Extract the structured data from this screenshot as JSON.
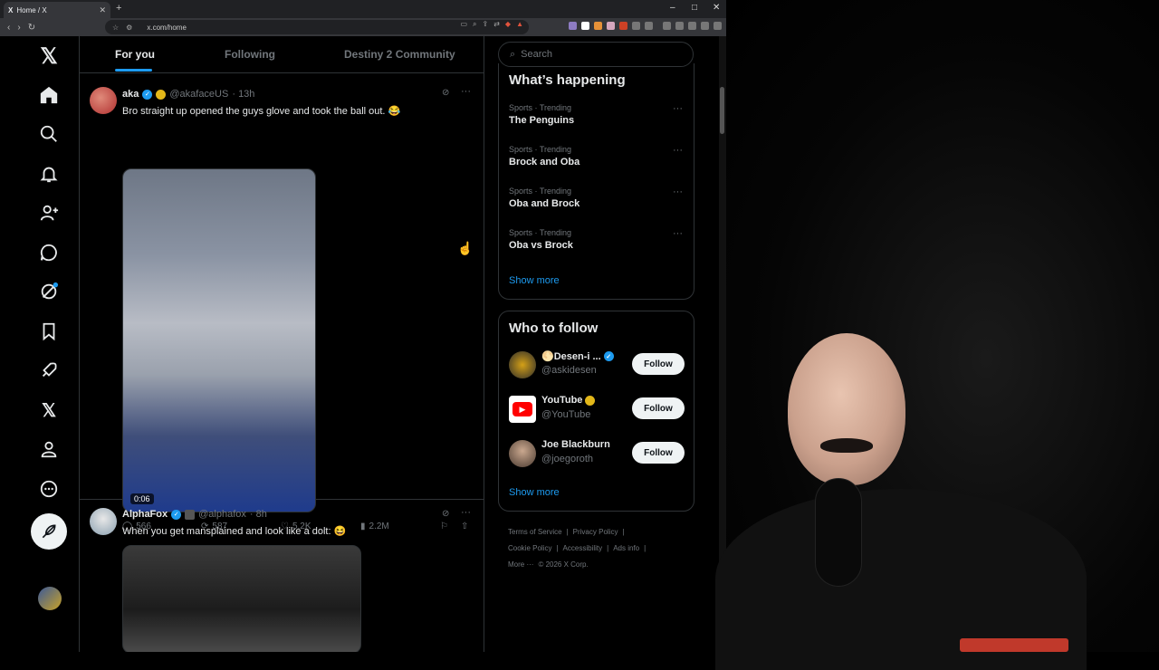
{
  "browser": {
    "tab_title": "Home / X",
    "tab_favicon": "X",
    "url": "x.com/home",
    "new_tab": "+",
    "minimize": "–",
    "maximize": "□",
    "close": "✕"
  },
  "x": {
    "logo": "𝕏",
    "tabs": [
      {
        "label": "For you",
        "active": true
      },
      {
        "label": "Following"
      },
      {
        "label": "Destiny 2 Community"
      }
    ],
    "nav": [
      "home-icon",
      "search-icon",
      "notifications-icon",
      "follow-icon",
      "messages-icon",
      "grok-icon",
      "bookmarks-icon",
      "jobs-icon",
      "premium-icon",
      "profile-icon",
      "more-icon"
    ],
    "posts": [
      {
        "name": "aka",
        "handle": "@akafaceUS",
        "time": "· 13h",
        "text": "Bro straight up opened the guys glove and took the ball out. 😂",
        "duration": "0:06",
        "replies": "566",
        "reposts": "587",
        "likes": "5.2K",
        "views": "2.2M"
      },
      {
        "name": "AlphaFox",
        "handle": "@alphafox",
        "time": "· 8h",
        "text": "When you get mansplained and look like a dolt: 😆"
      }
    ],
    "search_placeholder": "Search",
    "whats_happening": {
      "title": "What’s happening",
      "trends": [
        {
          "meta": "Sports · Trending",
          "name": "The Penguins"
        },
        {
          "meta": "Sports · Trending",
          "name": "Brock and Oba"
        },
        {
          "meta": "Sports · Trending",
          "name": "Oba and Brock"
        },
        {
          "meta": "Sports · Trending",
          "name": "Oba vs Brock"
        }
      ],
      "show_more": "Show more"
    },
    "who_to_follow": {
      "title": "Who to follow",
      "accounts": [
        {
          "name": "🌕Desen-i ...",
          "handle": "@askidesen",
          "button": "Follow"
        },
        {
          "name": "YouTube",
          "handle": "@YouTube",
          "button": "Follow"
        },
        {
          "name": "Joe Blackburn",
          "handle": "@joegoroth",
          "button": "Follow"
        }
      ],
      "show_more": "Show more"
    },
    "footer": {
      "terms": "Terms of Service",
      "privacy": "Privacy Policy",
      "cookie": "Cookie Policy",
      "accessibility": "Accessibility",
      "ads": "Ads info",
      "more": "More ···",
      "copyright": "© 2026 X Corp."
    },
    "colors": {
      "accent": "#1d9bf0",
      "background": "#000000",
      "border": "#2f3336",
      "muted": "#71767b"
    }
  }
}
